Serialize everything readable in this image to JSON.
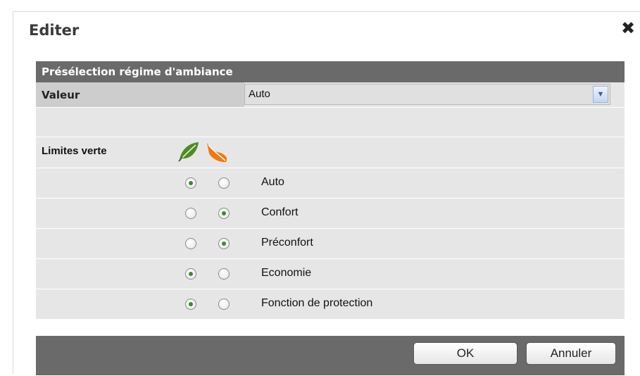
{
  "dialog": {
    "title": "Editer",
    "close_symbol": "✖"
  },
  "section": {
    "title": "Présélection régime d'ambiance"
  },
  "valeur": {
    "label": "Valeur",
    "selected": "Auto"
  },
  "limits": {
    "label": "Limites verte",
    "icons": [
      "green-leaf-icon",
      "orange-leaf-icon"
    ]
  },
  "options": [
    {
      "label": "Auto",
      "green_checked": true,
      "orange_checked": false
    },
    {
      "label": "Confort",
      "green_checked": false,
      "orange_checked": true
    },
    {
      "label": "Préconfort",
      "green_checked": false,
      "orange_checked": true
    },
    {
      "label": "Economie",
      "green_checked": true,
      "orange_checked": false
    },
    {
      "label": "Fonction de protection",
      "green_checked": true,
      "orange_checked": false
    }
  ],
  "buttons": {
    "ok": "OK",
    "cancel": "Annuler"
  },
  "colors": {
    "header_bg": "#6a6a6a",
    "row_bg": "#e6e6e6",
    "radio_dot": "#3a8a2a",
    "leaf_green": "#4f8a26",
    "leaf_orange": "#f07a10"
  }
}
